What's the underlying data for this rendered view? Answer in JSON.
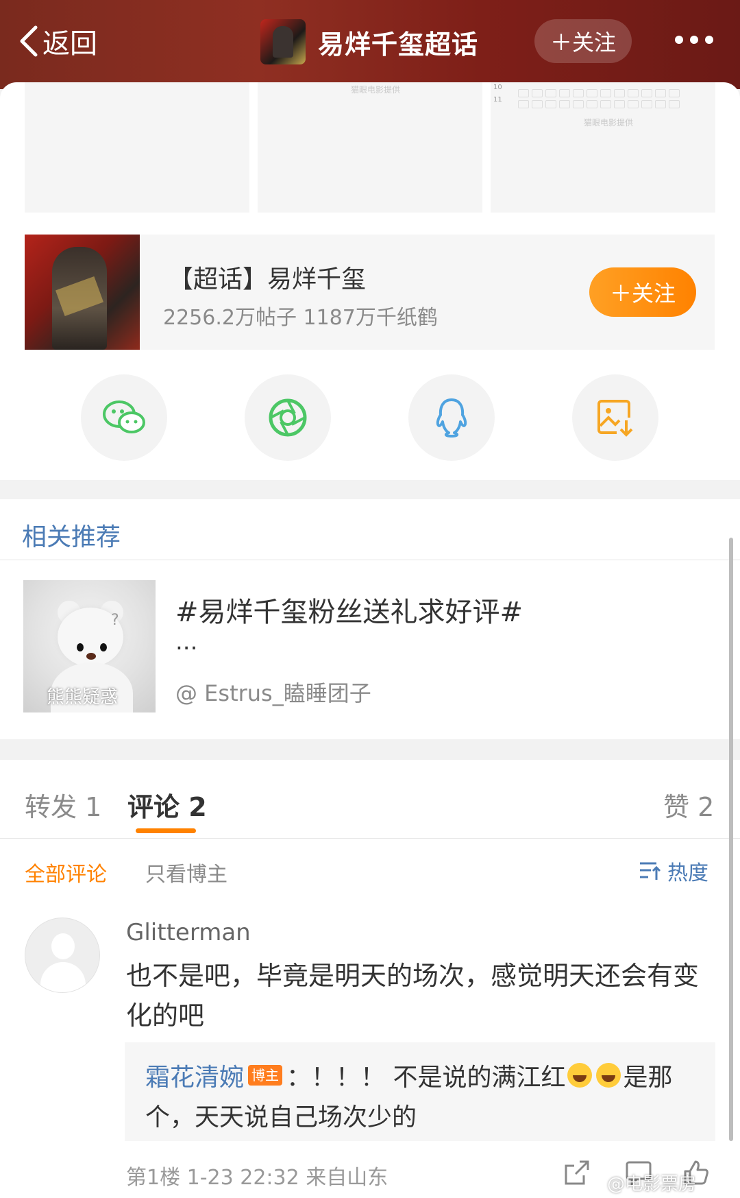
{
  "header": {
    "back_label": "返回",
    "title": "易烊千玺超话",
    "follow_label": "＋关注",
    "bg_color": "#7e1f18"
  },
  "thumbnails": {
    "watermark": "猫眼电影提供",
    "row_numbers": [
      "10",
      "11"
    ]
  },
  "topic_card": {
    "title": "【超话】易烊千玺",
    "stats": "2256.2万帖子 1187万千纸鹤",
    "follow_label": "＋关注",
    "accent_color": "#ff8200"
  },
  "share_buttons": [
    {
      "icon": "wechat-icon",
      "color": "#4cc765"
    },
    {
      "icon": "moments-icon",
      "color": "#4cc765"
    },
    {
      "icon": "qq-icon",
      "color": "#4fa3e0"
    },
    {
      "icon": "save-image-icon",
      "color": "#f6a623"
    }
  ],
  "recommend": {
    "title": "相关推荐",
    "image_caption": "熊熊疑惑",
    "hashtag": "#易烊千玺粉丝送礼求好评#",
    "ellipsis": "...",
    "author": "@ Estrus_瞌睡团子"
  },
  "tabs": [
    {
      "label": "转发 1"
    },
    {
      "label": "评论 2"
    },
    {
      "label": "赞 2"
    }
  ],
  "filters": {
    "all": "全部评论",
    "author_only": "只看博主",
    "sort": "热度"
  },
  "comment": {
    "username": "Glitterman",
    "text": "也不是吧，毕竟是明天的场次，感觉明天还会有变化的吧",
    "reply": {
      "username": "霜花清婉",
      "badge": "博主",
      "text_before": "：！！！ 不是说的满江红",
      "text_after": "是那",
      "line2": "个，天天说自己场次少的"
    },
    "meta": "第1楼 1-23 22:32 来自山东"
  },
  "watermark": "@电影票房",
  "colors": {
    "link_blue": "#4b7bb5",
    "orange": "#ff8200"
  }
}
